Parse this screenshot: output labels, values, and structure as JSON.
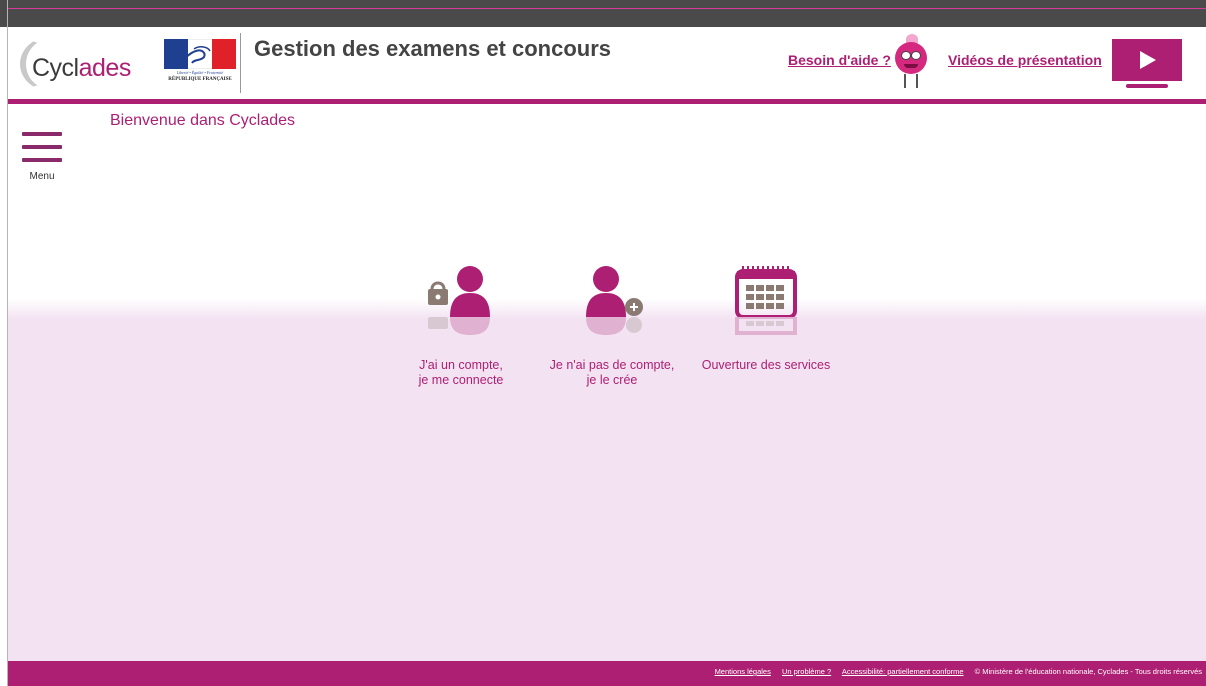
{
  "header": {
    "logo_text_plain": "Cycl",
    "logo_text_accent": "ades",
    "motto": "Liberté • Égalité • Fraternité",
    "republic": "RÉPUBLIQUE FRANÇAISE",
    "title": "Gestion des examens et concours",
    "help_link": "Besoin d'aide ?",
    "video_link": "Vidéos de présentation"
  },
  "menu": {
    "label": "Menu"
  },
  "welcome": "Bienvenue dans Cyclades",
  "tiles": [
    {
      "line1": "J'ai un compte,",
      "line2": "je me connecte",
      "icon": "user-lock-icon"
    },
    {
      "line1": "Je n'ai pas de compte,",
      "line2": "je le crée",
      "icon": "user-add-icon"
    },
    {
      "line1": "Ouverture des services",
      "line2": "",
      "icon": "calendar-icon"
    }
  ],
  "footer": {
    "legal": "Mentions légales",
    "problem": "Un problème ?",
    "accessibility": "Accessibilité: partiellement conforme",
    "copyright": "© Ministère de l'éducation nationale, Cyclades - Tous droits réservés"
  },
  "colors": {
    "brand": "#ad1f73",
    "content_bg": "#f3e3f2",
    "topbar": "#4a4a4a",
    "icon_gray": "#8a7a72"
  }
}
